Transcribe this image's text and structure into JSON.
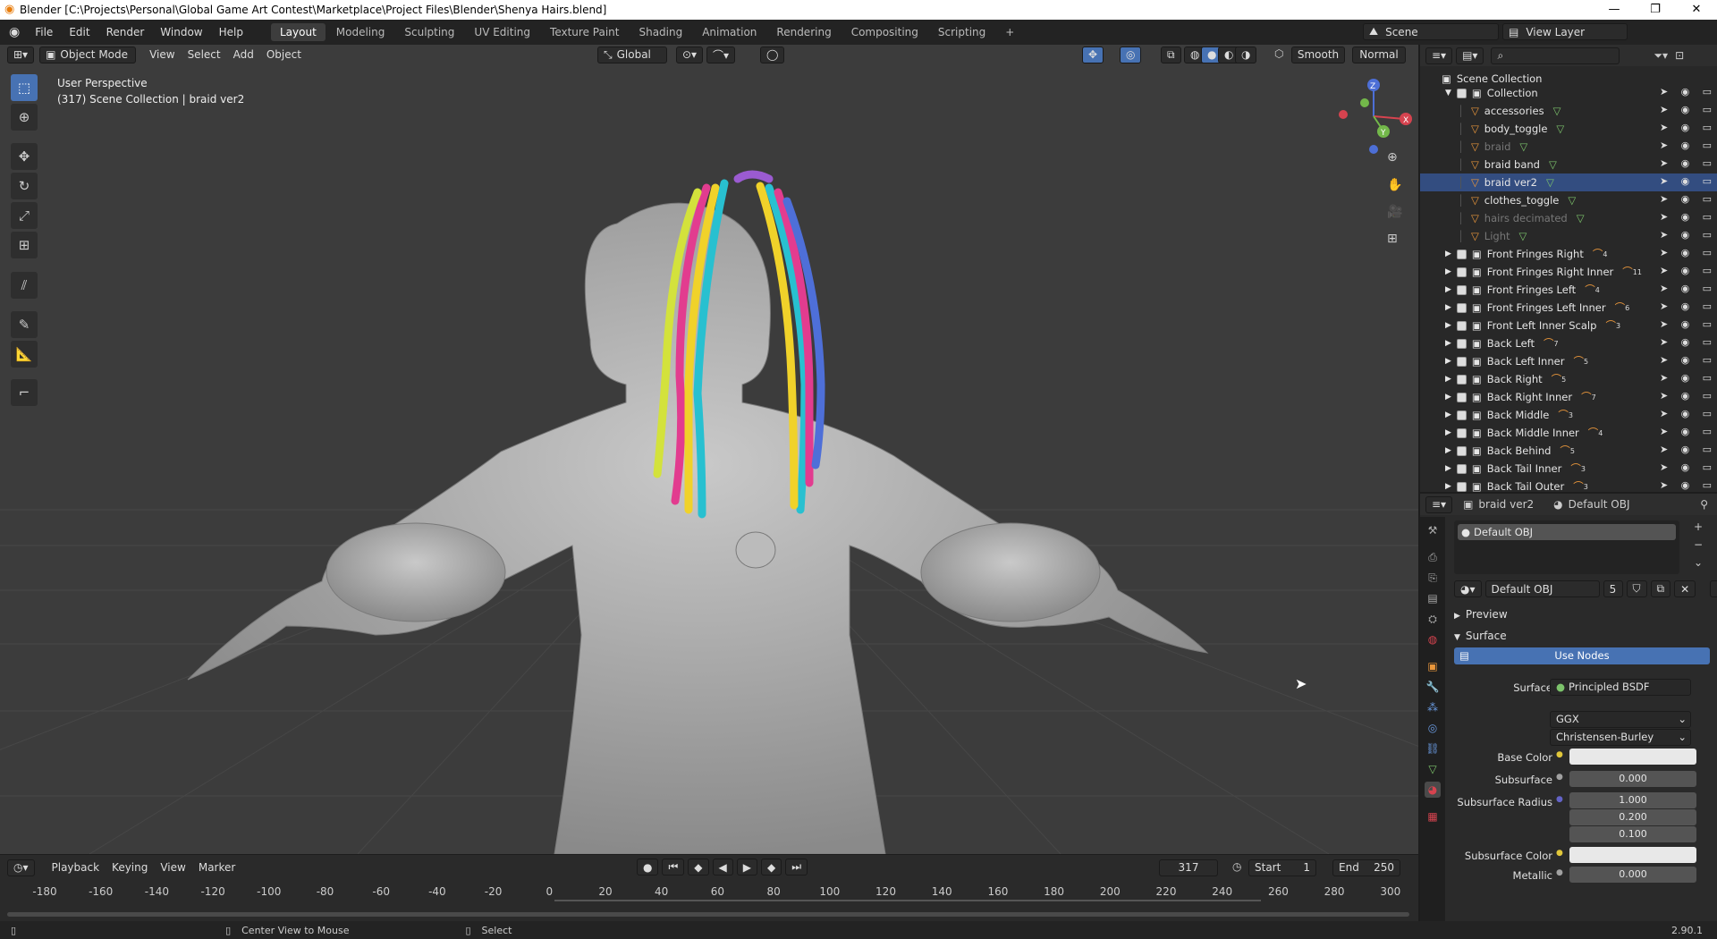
{
  "window": {
    "title": "Blender [C:\\Projects\\Personal\\Global Game Art Contest\\Marketplace\\Project Files\\Blender\\Shenya Hairs.blend]"
  },
  "menus": [
    "File",
    "Edit",
    "Render",
    "Window",
    "Help"
  ],
  "workspaces": [
    "Layout",
    "Modeling",
    "Sculpting",
    "UV Editing",
    "Texture Paint",
    "Shading",
    "Animation",
    "Rendering",
    "Compositing",
    "Scripting"
  ],
  "scene": {
    "name": "Scene",
    "view_layer": "View Layer"
  },
  "viewport": {
    "mode": "Object Mode",
    "menus": [
      "View",
      "Select",
      "Add",
      "Object"
    ],
    "orientation": "Global",
    "shading_smooth": "Smooth",
    "shading_normal": "Normal",
    "info_line1": "User Perspective",
    "info_line2": "(317) Scene Collection | braid ver2",
    "gizmo_labels": [
      "Z",
      "Y",
      "X"
    ]
  },
  "outliner": {
    "root": "Scene Collection",
    "collection": "Collection",
    "children": [
      {
        "name": "accessories",
        "dim": false
      },
      {
        "name": "body_toggle",
        "dim": false
      },
      {
        "name": "braid",
        "dim": true
      },
      {
        "name": "braid band",
        "dim": false
      },
      {
        "name": "braid ver2",
        "dim": false
      },
      {
        "name": "clothes_toggle",
        "dim": false
      },
      {
        "name": "hairs decimated",
        "dim": true
      },
      {
        "name": "Light",
        "dim": true
      }
    ],
    "collections": [
      {
        "name": "Front Fringes Right",
        "count": "4"
      },
      {
        "name": "Front Fringes Right Inner",
        "count": "11"
      },
      {
        "name": "Front Fringes Left",
        "count": "4"
      },
      {
        "name": "Front Fringes Left Inner",
        "count": "6"
      },
      {
        "name": "Front Left Inner Scalp",
        "count": "3"
      },
      {
        "name": "Back Left",
        "count": "7"
      },
      {
        "name": "Back Left Inner",
        "count": "5"
      },
      {
        "name": "Back Right",
        "count": "5"
      },
      {
        "name": "Back Right Inner",
        "count": "7"
      },
      {
        "name": "Back Middle",
        "count": "3"
      },
      {
        "name": "Back Middle Inner",
        "count": "4"
      },
      {
        "name": "Back Behind",
        "count": "5"
      },
      {
        "name": "Back Tail Inner",
        "count": "3"
      },
      {
        "name": "Back Tail Outer",
        "count": "3"
      }
    ]
  },
  "properties": {
    "object": "braid ver2",
    "material": "Default OBJ",
    "slot": "Default OBJ",
    "material_field": "Default OBJ",
    "users": "5",
    "preview": "Preview",
    "surface_panel": "Surface",
    "use_nodes": "Use Nodes",
    "surface_label": "Surface",
    "surface_value": "Principled BSDF",
    "distribution": "GGX",
    "subsurface_method": "Christensen-Burley",
    "base_color_label": "Base Color",
    "base_color": "#e8e8e8",
    "subsurface_label": "Subsurface",
    "subsurface": "0.000",
    "subsurface_radius_label": "Subsurface Radius",
    "radius": [
      "1.000",
      "0.200",
      "0.100"
    ],
    "subsurface_color_label": "Subsurface Color",
    "metallic_label": "Metallic",
    "metallic": "0.000"
  },
  "timeline": {
    "menus": [
      "Playback",
      "Keying",
      "View",
      "Marker"
    ],
    "current_frame": "317",
    "start_label": "Start",
    "start": "1",
    "end_label": "End",
    "end": "250",
    "ticks": [
      "-180",
      "-160",
      "-140",
      "-120",
      "-100",
      "-80",
      "-60",
      "-40",
      "-20",
      "0",
      "20",
      "40",
      "60",
      "80",
      "100",
      "120",
      "140",
      "160",
      "180",
      "200",
      "220",
      "240",
      "260",
      "280",
      "300"
    ]
  },
  "status": {
    "hint1": "Center View to Mouse",
    "hint2": "Select",
    "version": "2.90.1"
  },
  "colors": {
    "accent": "#4772b3",
    "selected_row": "#334d80"
  }
}
